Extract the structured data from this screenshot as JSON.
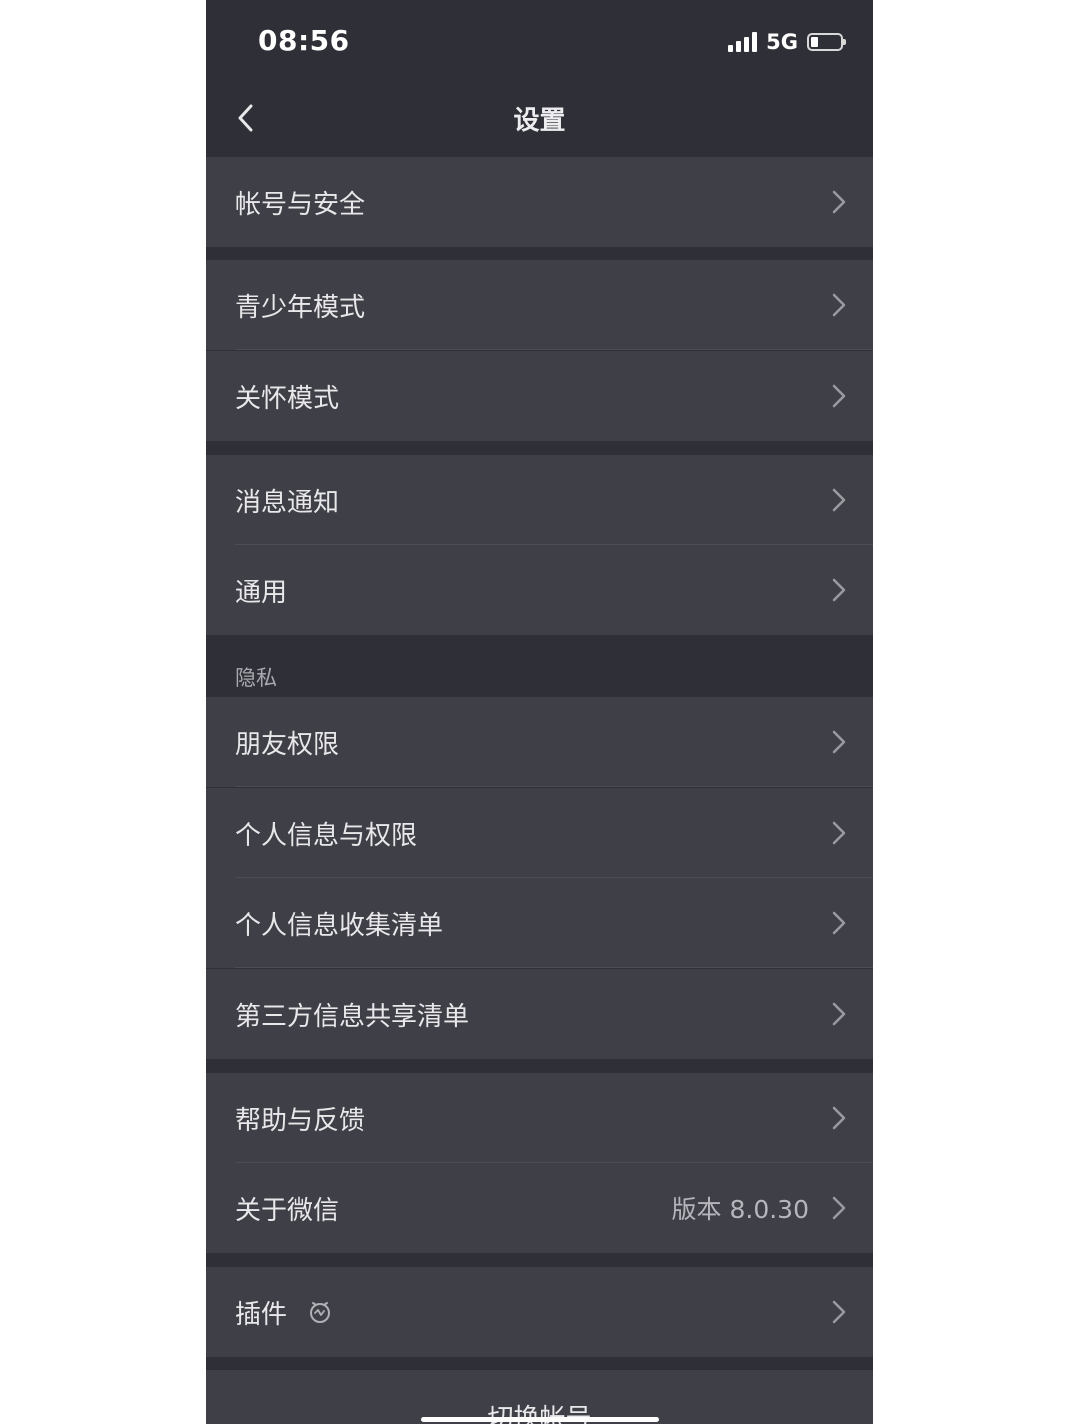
{
  "status_bar": {
    "time": "08:56",
    "network": "5G"
  },
  "nav": {
    "title": "设置",
    "back_icon": "chevron-left-icon"
  },
  "menu_groups": [
    {
      "items": [
        {
          "label": "帐号与安全"
        }
      ]
    },
    {
      "items": [
        {
          "label": "青少年模式"
        },
        {
          "label": "关怀模式"
        }
      ]
    },
    {
      "items": [
        {
          "label": "消息通知"
        },
        {
          "label": "通用"
        }
      ]
    },
    {
      "header": "隐私",
      "items": [
        {
          "label": "朋友权限"
        },
        {
          "label": "个人信息与权限"
        },
        {
          "label": "个人信息收集清单"
        },
        {
          "label": "第三方信息共享清单"
        }
      ]
    },
    {
      "items": [
        {
          "label": "帮助与反馈"
        },
        {
          "label": "关于微信",
          "value": "版本 8.0.30"
        }
      ]
    },
    {
      "items": [
        {
          "label": "插件",
          "icon": "plugin-icon"
        }
      ]
    }
  ],
  "bottom_action": {
    "label": "切换帐号"
  },
  "colors": {
    "page_background": "#2f2f37",
    "cell_background": "#3f3f47",
    "text": "#e8e8ea",
    "secondary_text": "#b5b5bb"
  }
}
